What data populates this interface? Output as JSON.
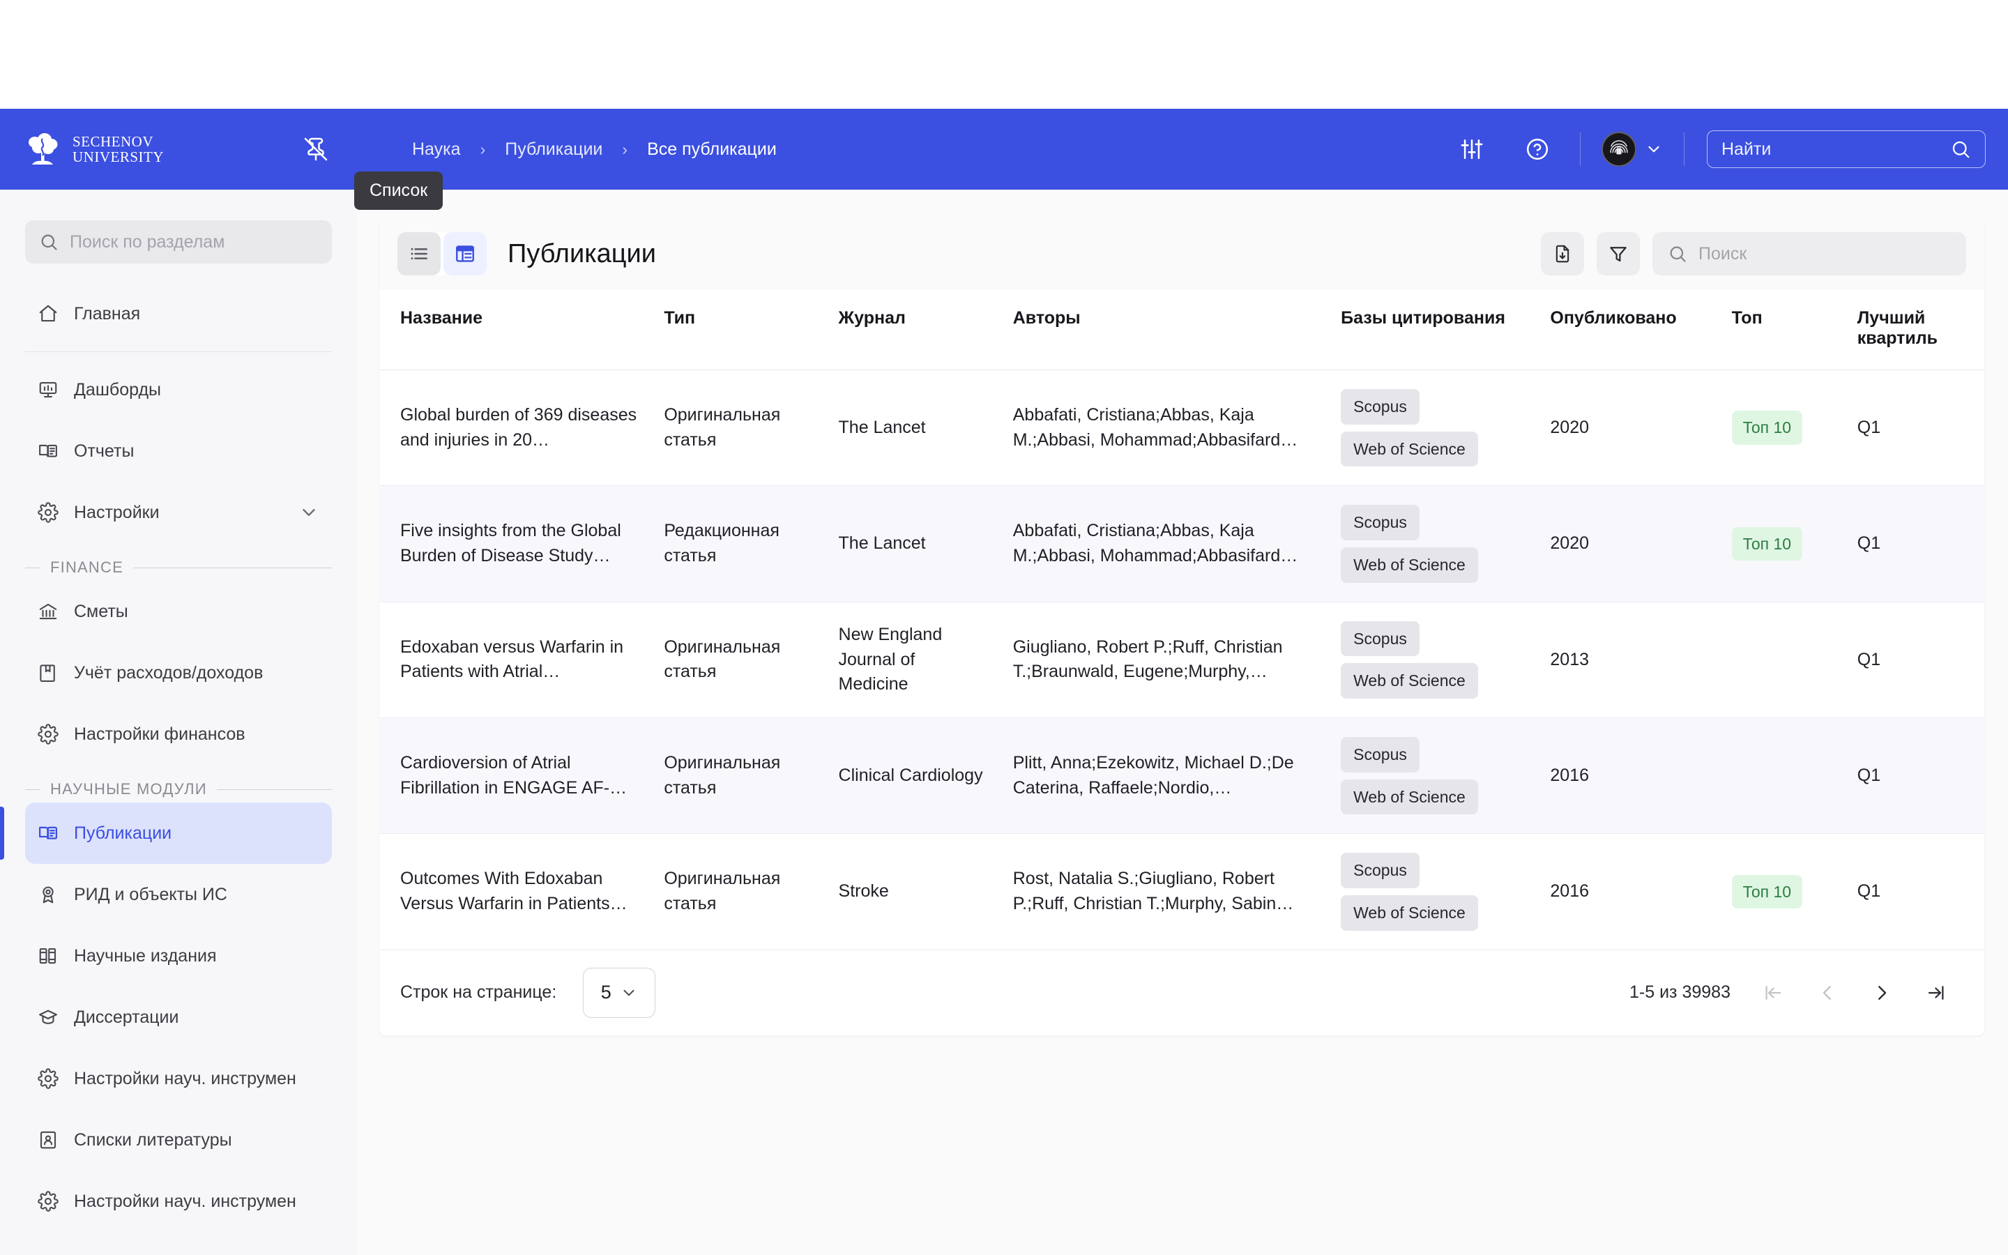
{
  "topbar": {
    "brand_line1": "SECHENOV",
    "brand_line2": "UNIVERSITY",
    "pin_icon": "pin-off-icon",
    "breadcrumb": [
      "Наука",
      "Публикации",
      "Все публикации"
    ],
    "breadcrumb_separator": "›",
    "settings_icon": "sliders-icon",
    "help_icon": "help-circle-icon",
    "avatar_icon": "fingerprint-avatar",
    "avatar_chevron_icon": "chevron-down-icon",
    "search_placeholder": "Найти",
    "search_value": "",
    "search_icon": "search-icon",
    "accent_color": "#3B4FE0"
  },
  "tooltip": {
    "text": "Список"
  },
  "sidebar": {
    "search_placeholder": "Поиск по разделам",
    "search_value": "",
    "search_icon": "search-icon",
    "items": [
      {
        "label": "Главная",
        "icon": "home-icon",
        "active": false,
        "chevron": false
      },
      {
        "label": "Дашборды",
        "icon": "dashboard-icon",
        "active": false,
        "chevron": false
      },
      {
        "label": "Отчеты",
        "icon": "book-icon",
        "active": false,
        "chevron": false
      },
      {
        "label": "Настройки",
        "icon": "gear-icon",
        "active": false,
        "chevron": true
      }
    ],
    "group_finance": "FINANCE",
    "finance_items": [
      {
        "label": "Сметы",
        "icon": "bank-icon",
        "active": false
      },
      {
        "label": "Учёт расходов/доходов",
        "icon": "ledger-icon",
        "active": false
      },
      {
        "label": "Настройки финансов",
        "icon": "gear-icon",
        "active": false
      }
    ],
    "group_science": "НАУЧНЫЕ МОДУЛИ",
    "science_items": [
      {
        "label": "Публикации",
        "icon": "book-open-icon",
        "active": true
      },
      {
        "label": "РИД и объекты ИС",
        "icon": "award-icon",
        "active": false
      },
      {
        "label": "Научные издания",
        "icon": "books-icon",
        "active": false
      },
      {
        "label": "Диссертации",
        "icon": "graduation-cap-icon",
        "active": false
      },
      {
        "label": "Настройки науч. инструмен",
        "icon": "gear-icon",
        "active": false
      },
      {
        "label": "Списки литературы",
        "icon": "contact-icon",
        "active": false
      },
      {
        "label": "Настройки науч. инструмен",
        "icon": "gear-icon",
        "active": false
      }
    ]
  },
  "content": {
    "title": "Публикации",
    "view_list_icon": "list-view-icon",
    "view_table_icon": "table-view-icon",
    "export_icon": "file-download-icon",
    "filter_icon": "funnel-icon",
    "search_placeholder": "Поиск",
    "search_value": "",
    "search_icon": "search-icon",
    "columns": [
      "Название",
      "Тип",
      "Журнал",
      "Авторы",
      "Базы цитирования",
      "Опубликовано",
      "Топ",
      "Лучший квартиль"
    ],
    "rows": [
      {
        "name": "Global burden of 369 diseases and injuries in 20…",
        "type": "Оригинальная статья",
        "journal": "The Lancet",
        "authors": "Abbafati, Cristiana;Abbas, Kaja M.;Abbasi, Mohammad;Abbasifard…",
        "bases": [
          "Scopus",
          "Web of Science"
        ],
        "published": "2020",
        "top": "Топ 10",
        "quartile": "Q1"
      },
      {
        "name": "Five insights from the Global Burden of Disease Study…",
        "type": "Редакционная статья",
        "journal": "The Lancet",
        "authors": "Abbafati, Cristiana;Abbas, Kaja M.;Abbasi, Mohammad;Abbasifard…",
        "bases": [
          "Scopus",
          "Web of Science"
        ],
        "published": "2020",
        "top": "Топ 10",
        "quartile": "Q1"
      },
      {
        "name": "Edoxaban versus Warfarin in Patients with Atrial…",
        "type": "Оригинальная статья",
        "journal": "New England Journal of Medicine",
        "authors": "Giugliano, Robert P.;Ruff, Christian T.;Braunwald, Eugene;Murphy,…",
        "bases": [
          "Scopus",
          "Web of Science"
        ],
        "published": "2013",
        "top": "",
        "quartile": "Q1"
      },
      {
        "name": "Cardioversion of Atrial Fibrillation in ENGAGE AF-…",
        "type": "Оригинальная статья",
        "journal": "Clinical Cardiology",
        "authors": "Plitt, Anna;Ezekowitz, Michael D.;De Caterina, Raffaele;Nordio,…",
        "bases": [
          "Scopus",
          "Web of Science"
        ],
        "published": "2016",
        "top": "",
        "quartile": "Q1"
      },
      {
        "name": "Outcomes With Edoxaban Versus Warfarin in Patients…",
        "type": "Оригинальная статья",
        "journal": "Stroke",
        "authors": "Rost, Natalia S.;Giugliano, Robert P.;Ruff, Christian T.;Murphy, Sabin…",
        "bases": [
          "Scopus",
          "Web of Science"
        ],
        "published": "2016",
        "top": "Топ 10",
        "quartile": "Q1"
      }
    ]
  },
  "footer": {
    "rows_label": "Строк на странице:",
    "rows_value": "5",
    "rows_chevron_icon": "chevron-down-icon",
    "range_text": "1-5 из 39983",
    "first_icon": "first-page-icon",
    "prev_icon": "chevron-left-icon",
    "next_icon": "chevron-right-icon",
    "last_icon": "last-page-icon"
  }
}
